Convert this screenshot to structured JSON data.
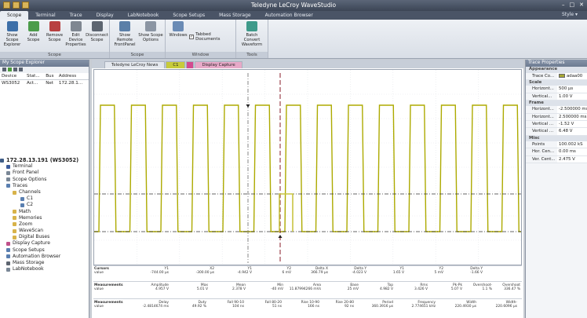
{
  "app": {
    "title": "Teledyne LeCroy WaveStudio",
    "style_label": "Style"
  },
  "menu": {
    "tabs": [
      "Scope",
      "Terminal",
      "Trace",
      "Display",
      "LabNotebook",
      "Scope Setups",
      "Mass Storage",
      "Automation Browser"
    ]
  },
  "ribbon": {
    "scope_group": {
      "label": "Scope",
      "buttons": [
        "Show Scope Explorer",
        "Add Scope",
        "Remove Scope",
        "Edit Device Properties",
        "Disconnect Scope"
      ]
    },
    "scope2_group": {
      "label": "Scope",
      "buttons": [
        "Show Remote FrontPanel",
        "Show Scope Options"
      ]
    },
    "window_group": {
      "label": "Window",
      "button": "Windows",
      "tabbed_label": "Tabbed Documents"
    },
    "tools_group": {
      "label": "Tools",
      "button": "Batch Convert Waveform"
    }
  },
  "explorer": {
    "title": "My Scope Explorer",
    "headers": [
      "Device",
      "Stat...",
      "Bus",
      "Address"
    ],
    "devices": [
      {
        "name": "WS3052",
        "status": "Act...",
        "bus": "Net",
        "address": "172.28.1..."
      }
    ]
  },
  "tree": {
    "root": "172.28.13.191 (WS3052)",
    "nodes": [
      "Terminal",
      "Front Panel",
      "Scope Options",
      "Traces",
      "Channels",
      "C1",
      "C2",
      "Math",
      "Memories",
      "Zoom",
      "WaveScan",
      "Digital Buses",
      "Display Capture",
      "Scope Setups",
      "Automation Browser",
      "Mass Storage",
      "LabNotebook"
    ]
  },
  "doctabs": [
    "Teledyne LeCroy News",
    "C1",
    "",
    "Display Capture"
  ],
  "measurements": {
    "row1": {
      "label": "Cursors",
      "sub": "value",
      "cols": [
        [
          "Y1",
          "-744.00 µs"
        ],
        [
          "X2",
          "-300.00 µs"
        ],
        [
          "Y1",
          "-4.942 V"
        ],
        [
          "Y2",
          "6 mV"
        ],
        [
          "Delta X",
          "366.79 µs"
        ],
        [
          "Delta Y",
          "-4.023 V"
        ],
        [
          "Y1",
          "1.65 V"
        ],
        [
          "Y2",
          "5 mV"
        ],
        [
          "Delta Y",
          "-1.66 V"
        ]
      ]
    },
    "row2": {
      "label": "Measurements",
      "sub": "value",
      "cols": [
        [
          "Amplitude",
          "4.957 V"
        ],
        [
          "Max",
          "5.01 V"
        ],
        [
          "Mean",
          "2.378 V"
        ],
        [
          "Min",
          "-40 mV"
        ],
        [
          "Area",
          "11.87994266 mVs"
        ],
        [
          "Base",
          "25 mV"
        ],
        [
          "Top",
          "4.982 V"
        ],
        [
          "Rms",
          "3.426 V"
        ],
        [
          "Pk-Pk",
          "5.07 V"
        ],
        [
          "Overshoot-",
          "1.1 %"
        ],
        [
          "Overshoot",
          "336.47 %"
        ]
      ]
    },
    "row3": {
      "label": "Measurements",
      "sub": "value",
      "cols": [
        [
          "Delay",
          "-2.4814674 ms"
        ],
        [
          "Duty",
          "49.92 %"
        ],
        [
          "Fall 90-10",
          "104 ns"
        ],
        [
          "Fall 80-20",
          "51 ns"
        ],
        [
          "Rise 10-90",
          "166 ns"
        ],
        [
          "Rise 20-80",
          "92 ns"
        ],
        [
          "Period",
          "360.3916 µs"
        ],
        [
          "Frequency",
          "2.774651 kHz"
        ],
        [
          "Width",
          "220.4930 µs"
        ],
        [
          "Width-",
          "220.6096 µs"
        ]
      ]
    }
  },
  "properties": {
    "title": "Trace Properties",
    "sections": [
      {
        "name": "Appearance",
        "rows": [
          [
            "Trace Co...",
            "adaa00"
          ]
        ]
      },
      {
        "name": "Scale",
        "rows": [
          [
            "Horizont...",
            "500 µs"
          ],
          [
            "Vertical...",
            "1.00 V"
          ]
        ]
      },
      {
        "name": "Frame",
        "rows": [
          [
            "Horizont...",
            "-2.500000 ms"
          ],
          [
            "Horizont...",
            "2.500000 ms"
          ],
          [
            "Vertical ...",
            "-1.52 V"
          ],
          [
            "Vertical ...",
            "6.48 V"
          ]
        ]
      },
      {
        "name": "Misc",
        "rows": [
          [
            "Points",
            "100.002 kS"
          ],
          [
            "Hor. Cen...",
            "0.00 ms"
          ],
          [
            "Ver. Cent...",
            "2.475 V"
          ]
        ]
      }
    ]
  },
  "colors": {
    "trace": "#adaa00",
    "cursor": "#8a1c2a"
  }
}
